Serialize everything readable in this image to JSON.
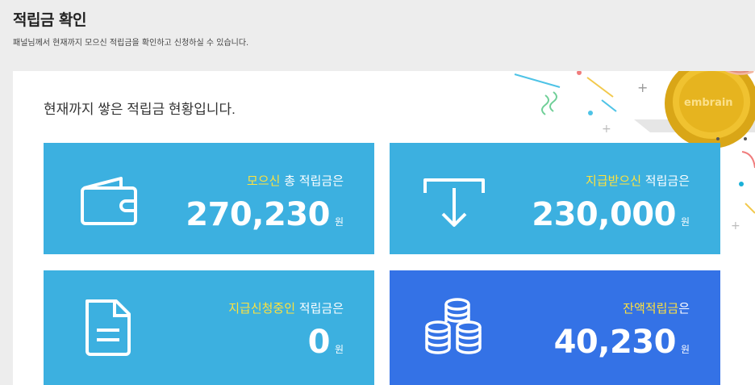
{
  "header": {
    "title": "적립금 확인",
    "subtitle": "패널님께서 현재까지 모으신 적립금을 확인하고 신청하실 수 있습니다."
  },
  "panel": {
    "heading": "현재까지 쌓은 적립금 현황입니다.",
    "logo_text": "embrain"
  },
  "cards": [
    {
      "highlight": "모으신",
      "rest": " 총 적립금은",
      "amount": "270,230",
      "unit": "원",
      "icon": "wallet-icon",
      "color": "#3cb0e0"
    },
    {
      "highlight": "지급받으신",
      "rest": " 적립금은",
      "amount": "230,000",
      "unit": "원",
      "icon": "withdraw-arrow-icon",
      "color": "#3cb0e0"
    },
    {
      "highlight": "지급신청중인",
      "rest": " 적립금은",
      "amount": "0",
      "unit": "원",
      "icon": "document-icon",
      "color": "#3cb0e0"
    },
    {
      "highlight": "잔액적립금",
      "rest": "은",
      "amount": "40,230",
      "unit": "원",
      "icon": "coins-icon",
      "color": "#3472e6"
    }
  ],
  "colors": {
    "card_blue": "#3cb0e0",
    "card_dark_blue": "#3472e6",
    "highlight_yellow": "#ffe23c"
  }
}
